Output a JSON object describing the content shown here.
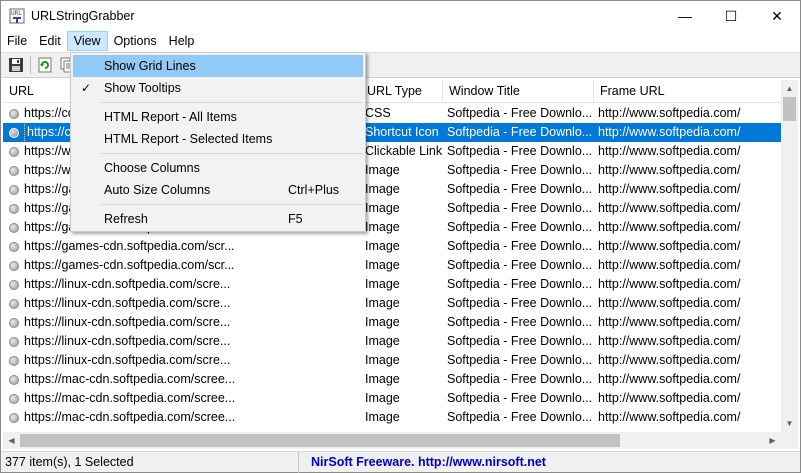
{
  "window": {
    "title": "URLStringGrabber",
    "minimize": "—",
    "maximize": "☐",
    "close": "✕"
  },
  "menubar": [
    "File",
    "Edit",
    "View",
    "Options",
    "Help"
  ],
  "toolbar": {
    "buttons": [
      "save-icon",
      "refresh-icon",
      "copy-icon"
    ]
  },
  "view_menu": {
    "items": [
      {
        "label": "Show Grid Lines",
        "shortcut": "",
        "checked": false,
        "hover": true
      },
      {
        "label": "Show Tooltips",
        "shortcut": "",
        "checked": true,
        "hover": false
      },
      {
        "sep": true
      },
      {
        "label": "HTML Report - All Items",
        "shortcut": ""
      },
      {
        "label": "HTML Report - Selected Items",
        "shortcut": ""
      },
      {
        "sep": true
      },
      {
        "label": "Choose Columns",
        "shortcut": ""
      },
      {
        "label": "Auto Size Columns",
        "shortcut": "Ctrl+Plus"
      },
      {
        "sep": true
      },
      {
        "label": "Refresh",
        "shortcut": "F5"
      }
    ],
    "check_glyph": "✓"
  },
  "table": {
    "columns": [
      "URL",
      "URL Type",
      "Window Title",
      "Frame URL"
    ],
    "rows": [
      {
        "url": "https://cdn.softpedia.com/css/styles.css",
        "type": "CSS",
        "title": "Softpedia - Free Downlo...",
        "frame": "http://www.softpedia.com/",
        "selected": false
      },
      {
        "url": "https://cdn.softpedia.com/favicon.ico",
        "type": "Shortcut Icon",
        "title": "Softpedia - Free Downlo...",
        "frame": "http://www.softpedia.com/",
        "selected": true
      },
      {
        "url": "https://www.softpedia.com/",
        "type": "Clickable Link",
        "title": "Softpedia - Free Downlo...",
        "frame": "http://www.softpedia.com/",
        "selected": false
      },
      {
        "url": "https://www.softpedia.com/images/logo.png",
        "type": "Image",
        "title": "Softpedia - Free Downlo...",
        "frame": "http://www.softpedia.com/",
        "selected": false
      },
      {
        "url": "https://games-cdn.softpedia.com/scre...",
        "type": "Image",
        "title": "Softpedia - Free Downlo...",
        "frame": "http://www.softpedia.com/",
        "selected": false
      },
      {
        "url": "https://games-cdn.softpedia.com/scre...",
        "type": "Image",
        "title": "Softpedia - Free Downlo...",
        "frame": "http://www.softpedia.com/",
        "selected": false
      },
      {
        "url": "https://games-cdn.softpedia.com/scr...",
        "type": "Image",
        "title": "Softpedia - Free Downlo...",
        "frame": "http://www.softpedia.com/",
        "selected": false
      },
      {
        "url": "https://games-cdn.softpedia.com/scr...",
        "type": "Image",
        "title": "Softpedia - Free Downlo...",
        "frame": "http://www.softpedia.com/",
        "selected": false
      },
      {
        "url": "https://games-cdn.softpedia.com/scr...",
        "type": "Image",
        "title": "Softpedia - Free Downlo...",
        "frame": "http://www.softpedia.com/",
        "selected": false
      },
      {
        "url": "https://linux-cdn.softpedia.com/scre...",
        "type": "Image",
        "title": "Softpedia - Free Downlo...",
        "frame": "http://www.softpedia.com/",
        "selected": false
      },
      {
        "url": "https://linux-cdn.softpedia.com/scre...",
        "type": "Image",
        "title": "Softpedia - Free Downlo...",
        "frame": "http://www.softpedia.com/",
        "selected": false
      },
      {
        "url": "https://linux-cdn.softpedia.com/scre...",
        "type": "Image",
        "title": "Softpedia - Free Downlo...",
        "frame": "http://www.softpedia.com/",
        "selected": false
      },
      {
        "url": "https://linux-cdn.softpedia.com/scre...",
        "type": "Image",
        "title": "Softpedia - Free Downlo...",
        "frame": "http://www.softpedia.com/",
        "selected": false
      },
      {
        "url": "https://linux-cdn.softpedia.com/scre...",
        "type": "Image",
        "title": "Softpedia - Free Downlo...",
        "frame": "http://www.softpedia.com/",
        "selected": false
      },
      {
        "url": "https://mac-cdn.softpedia.com/scree...",
        "type": "Image",
        "title": "Softpedia - Free Downlo...",
        "frame": "http://www.softpedia.com/",
        "selected": false
      },
      {
        "url": "https://mac-cdn.softpedia.com/scree...",
        "type": "Image",
        "title": "Softpedia - Free Downlo...",
        "frame": "http://www.softpedia.com/",
        "selected": false
      },
      {
        "url": "https://mac-cdn.softpedia.com/scree...",
        "type": "Image",
        "title": "Softpedia - Free Downlo...",
        "frame": "http://www.softpedia.com/",
        "selected": false
      }
    ]
  },
  "status": {
    "count": "377 item(s), 1 Selected",
    "credit": "NirSoft Freeware.  http://www.nirsoft.net"
  },
  "colors": {
    "selection": "#0078d7",
    "menu_hover": "#91c9f7",
    "menubar_active": "#cce8ff",
    "credit_link": "#0000cc"
  }
}
